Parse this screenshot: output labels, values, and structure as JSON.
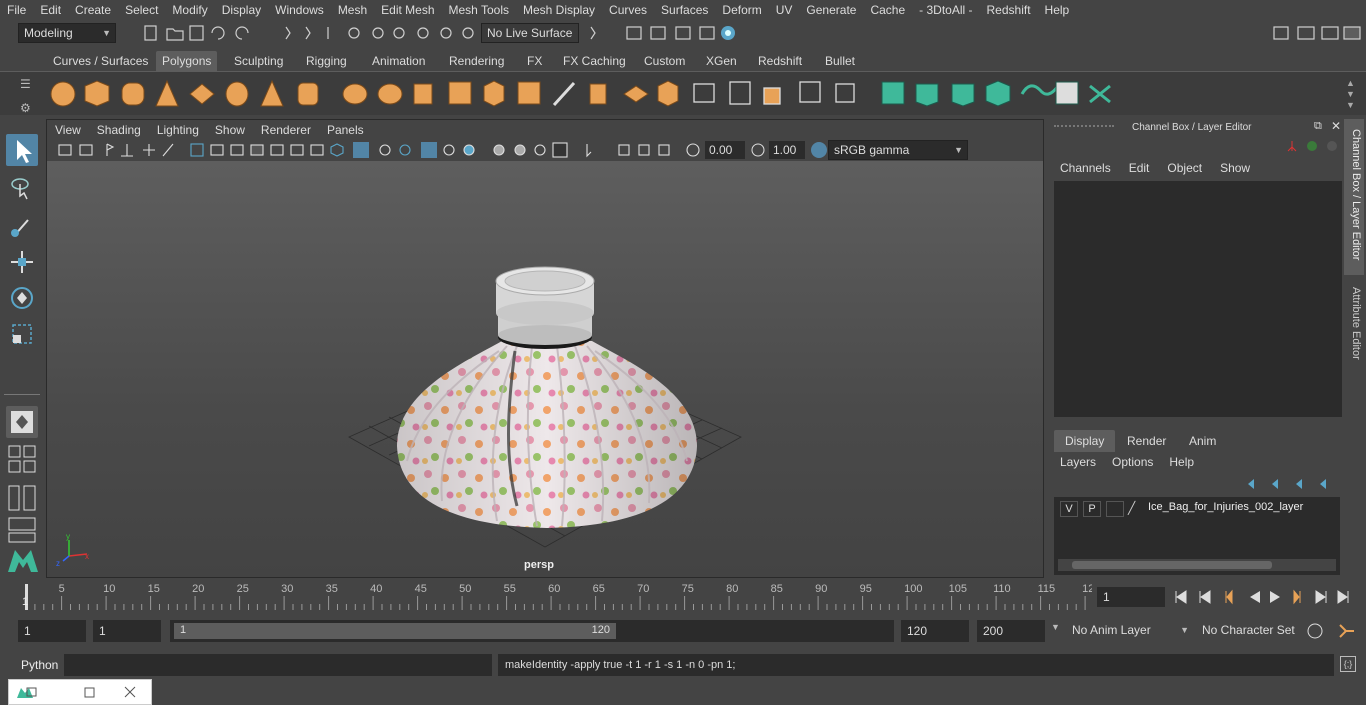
{
  "menu": [
    "File",
    "Edit",
    "Create",
    "Select",
    "Modify",
    "Display",
    "Windows",
    "Mesh",
    "Edit Mesh",
    "Mesh Tools",
    "Mesh Display",
    "Curves",
    "Surfaces",
    "Deform",
    "UV",
    "Generate",
    "Cache",
    "- 3DtoAll -",
    "Redshift",
    "Help"
  ],
  "status": {
    "workspace": "Modeling",
    "live_surface": "No Live Surface"
  },
  "shelf_tabs": [
    "Curves / Surfaces",
    "Polygons",
    "Sculpting",
    "Rigging",
    "Animation",
    "Rendering",
    "FX",
    "FX Caching",
    "Custom",
    "XGen",
    "Redshift",
    "Bullet"
  ],
  "active_shelf": "Polygons",
  "viewport": {
    "menu": [
      "View",
      "Shading",
      "Lighting",
      "Show",
      "Renderer",
      "Panels"
    ],
    "near_value": "0.00",
    "far_value": "1.00",
    "color_space": "sRGB gamma",
    "camera_label": "persp"
  },
  "right_panel": {
    "title": "Channel Box / Layer Editor",
    "channel_menu": [
      "Channels",
      "Edit",
      "Object",
      "Show"
    ],
    "layer_tabs": [
      "Display",
      "Render",
      "Anim"
    ],
    "active_layer_tab": "Display",
    "layer_menu": [
      "Layers",
      "Options",
      "Help"
    ],
    "layer": {
      "v": "V",
      "p": "P",
      "name": "Ice_Bag_for_Injuries_002_layer"
    },
    "vertical_tabs": [
      "Channel Box / Layer Editor",
      "Attribute Editor"
    ]
  },
  "timeline": {
    "ticks": [
      "5",
      "10",
      "15",
      "20",
      "25",
      "30",
      "35",
      "40",
      "45",
      "50",
      "55",
      "60",
      "65",
      "70",
      "75",
      "80",
      "85",
      "90",
      "95",
      "100",
      "105",
      "110",
      "115",
      "12"
    ],
    "start_marker": "1",
    "current_frame": "1"
  },
  "range": {
    "start": "1",
    "playback_start": "1",
    "slider_start": "1",
    "slider_end": "120",
    "playback_end": "120",
    "end": "200",
    "anim_layer": "No Anim Layer",
    "character_set": "No Character Set"
  },
  "command": {
    "language": "Python",
    "output": "makeIdentity -apply true -t 1 -r 1 -s 1 -n 0 -pn 1;"
  },
  "colors": {
    "accent": "#5285a6",
    "poly_icon": "#e8a257",
    "green_icon": "#3fb99a"
  }
}
